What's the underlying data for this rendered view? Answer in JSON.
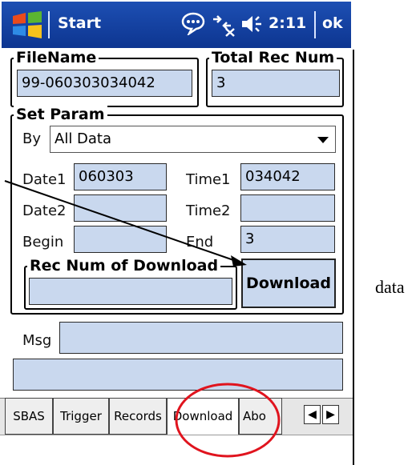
{
  "taskbar": {
    "start_label": "Start",
    "time": "2:11",
    "ok_label": "ok"
  },
  "filename": {
    "label": "FileName",
    "value": "99-060303034042"
  },
  "total_rec": {
    "label": "Total Rec Num",
    "value": "3"
  },
  "set_param": {
    "label": "Set Param",
    "by_label": "By",
    "by_value": "All Data",
    "date1_label": "Date1",
    "date1_value": "060303",
    "time1_label": "Time1",
    "time1_value": "034042",
    "date2_label": "Date2",
    "date2_value": "",
    "time2_label": "Time2",
    "time2_value": "",
    "begin_label": "Begin",
    "begin_value": "",
    "end_label": "End",
    "end_value": "3"
  },
  "rec_num_download": {
    "label": "Rec Num of Download",
    "value": ""
  },
  "download_button": "Download",
  "msg": {
    "label": "Msg",
    "value": "",
    "extra_value": ""
  },
  "tabs": [
    "SBAS",
    "Trigger",
    "Records",
    "Download",
    "Abo"
  ],
  "annotation": {
    "side_text": "data",
    "circle_color": "#e0141e"
  }
}
